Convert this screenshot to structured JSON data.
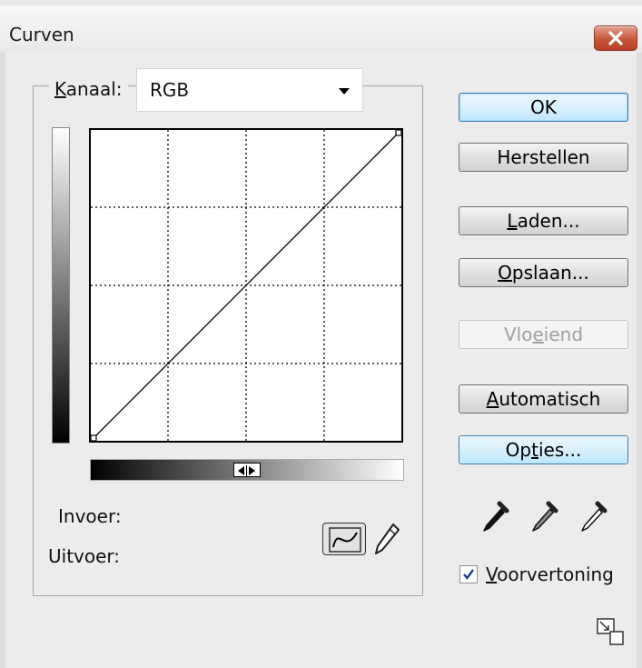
{
  "window": {
    "title": "Curven"
  },
  "channel": {
    "label_prefix": "K",
    "label_rest": "anaal:",
    "value": "RGB"
  },
  "curve": {
    "input_label": "Invoer:",
    "output_label": "Uitvoer:",
    "points": [
      [
        0,
        0
      ],
      [
        255,
        255
      ]
    ]
  },
  "buttons": {
    "ok": "OK",
    "reset": "Herstellen",
    "load_u": "L",
    "load_rest": "aden...",
    "save_u": "O",
    "save_rest": "pslaan...",
    "smooth_pre": "Vlo",
    "smooth_u": "e",
    "smooth_rest": "iend",
    "auto_u": "A",
    "auto_rest": "utomatisch",
    "options_pre": "Op",
    "options_u": "t",
    "options_rest": "ies..."
  },
  "preview": {
    "u": "V",
    "rest": "oorvertoning",
    "checked": true
  },
  "colors": {
    "accent": "#3c7fb1",
    "close": "#c8553c"
  },
  "icons": [
    "close-icon",
    "dropdown-arrow-icon",
    "curve-tool-icon",
    "pencil-icon",
    "black-eyedropper-icon",
    "gray-eyedropper-icon",
    "white-eyedropper-icon",
    "checkmark-icon",
    "resize-icon"
  ]
}
